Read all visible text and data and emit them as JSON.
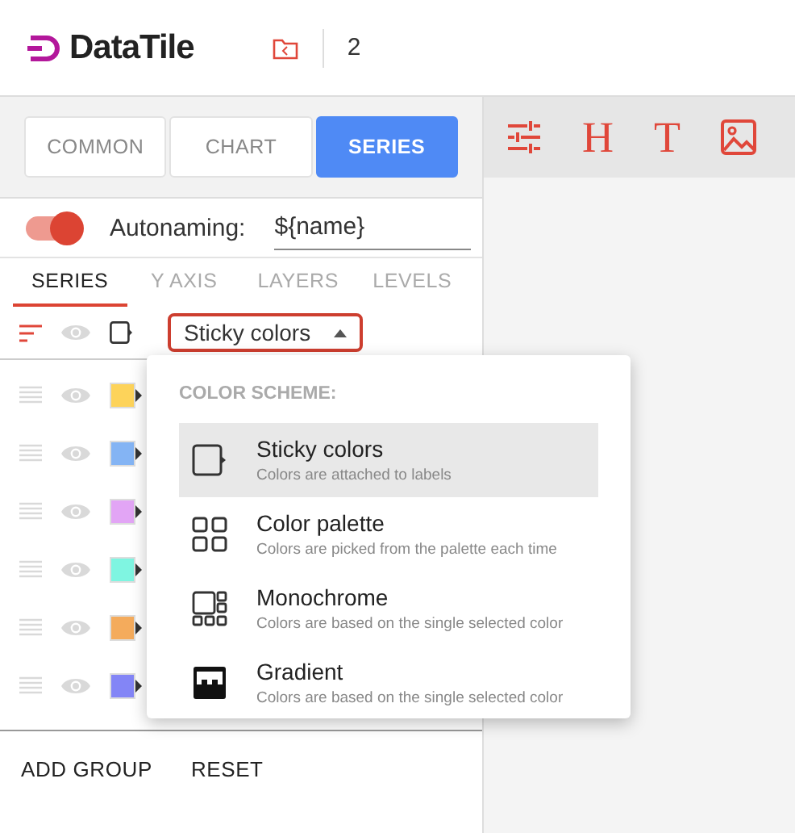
{
  "header": {
    "logo": "DataTile",
    "count": "2"
  },
  "toolbar": [
    {
      "kind": "sliders"
    },
    {
      "kind": "glyph",
      "char": "H"
    },
    {
      "kind": "glyph",
      "char": "T"
    },
    {
      "kind": "image"
    }
  ],
  "tabs": [
    {
      "label": "COMMON",
      "selected": false
    },
    {
      "label": "CHART",
      "selected": false
    },
    {
      "label": "SERIES",
      "selected": true
    }
  ],
  "autonaming": {
    "on": true,
    "label": "Autonaming:",
    "value": "${name}"
  },
  "subtabs": [
    {
      "label": "SERIES",
      "selected": true
    },
    {
      "label": "Y AXIS",
      "selected": false
    },
    {
      "label": "LAYERS",
      "selected": false
    },
    {
      "label": "LEVELS",
      "selected": false
    }
  ],
  "scheme_select": {
    "value": "Sticky colors",
    "expanded": true
  },
  "series": [
    {
      "color": "#fdd35a"
    },
    {
      "color": "#84b4f4"
    },
    {
      "color": "#e2a5f5"
    },
    {
      "color": "#7ff5e1"
    },
    {
      "color": "#f4ab5c"
    },
    {
      "color": "#8385f6"
    }
  ],
  "actions": [
    "ADD GROUP",
    "RESET"
  ],
  "menu": {
    "title": "COLOR SCHEME:",
    "items": [
      {
        "kind": "sticky",
        "label": "Sticky colors",
        "description": "Colors are attached to labels",
        "selected": true
      },
      {
        "kind": "palette",
        "label": "Color palette",
        "description": "Colors are picked from the palette each time",
        "selected": false
      },
      {
        "kind": "mono",
        "label": "Monochrome",
        "description": "Colors are based on the single selected color",
        "selected": false
      },
      {
        "kind": "gradient",
        "label": "Gradient",
        "description": "Colors are based on the single selected color",
        "selected": false
      }
    ]
  }
}
